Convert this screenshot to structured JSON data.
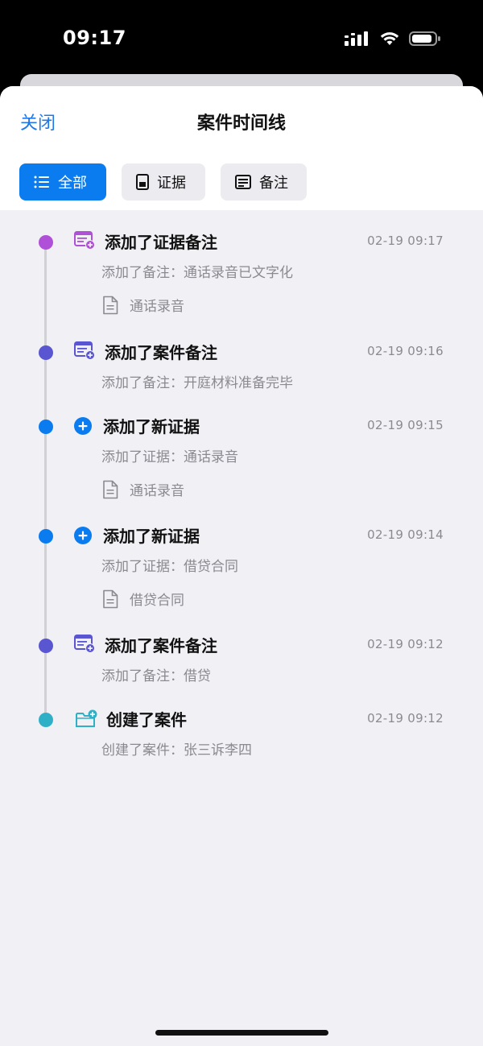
{
  "status": {
    "time": "09:17"
  },
  "header": {
    "close_label": "关闭",
    "title": "案件时间线"
  },
  "tabs": [
    {
      "label": "全部",
      "icon": "list-icon",
      "active": true
    },
    {
      "label": "证据",
      "icon": "document-icon",
      "active": false
    },
    {
      "label": "备注",
      "icon": "note-icon",
      "active": false
    }
  ],
  "events": [
    {
      "title": "添加了证据备注",
      "time": "02-19 09:17",
      "desc": "添加了备注：通话录音已文字化",
      "attachment": "通话录音",
      "icon": "note-add-icon",
      "color": "#b050d8"
    },
    {
      "title": "添加了案件备注",
      "time": "02-19 09:16",
      "desc": "添加了备注：开庭材料准备完毕",
      "attachment": "",
      "icon": "note-add-icon",
      "color": "#5a55d0"
    },
    {
      "title": "添加了新证据",
      "time": "02-19 09:15",
      "desc": "添加了证据：通话录音",
      "attachment": "通话录音",
      "icon": "plus-circle-icon",
      "color": "#0a7cf0"
    },
    {
      "title": "添加了新证据",
      "time": "02-19 09:14",
      "desc": "添加了证据：借贷合同",
      "attachment": "借贷合同",
      "icon": "plus-circle-icon",
      "color": "#0a7cf0"
    },
    {
      "title": "添加了案件备注",
      "time": "02-19 09:12",
      "desc": "添加了备注：借贷",
      "attachment": "",
      "icon": "note-add-icon",
      "color": "#5a55d0"
    },
    {
      "title": "创建了案件",
      "time": "02-19 09:12",
      "desc": "创建了案件：张三诉李四",
      "attachment": "",
      "icon": "folder-add-icon",
      "color": "#30b0c7"
    }
  ]
}
